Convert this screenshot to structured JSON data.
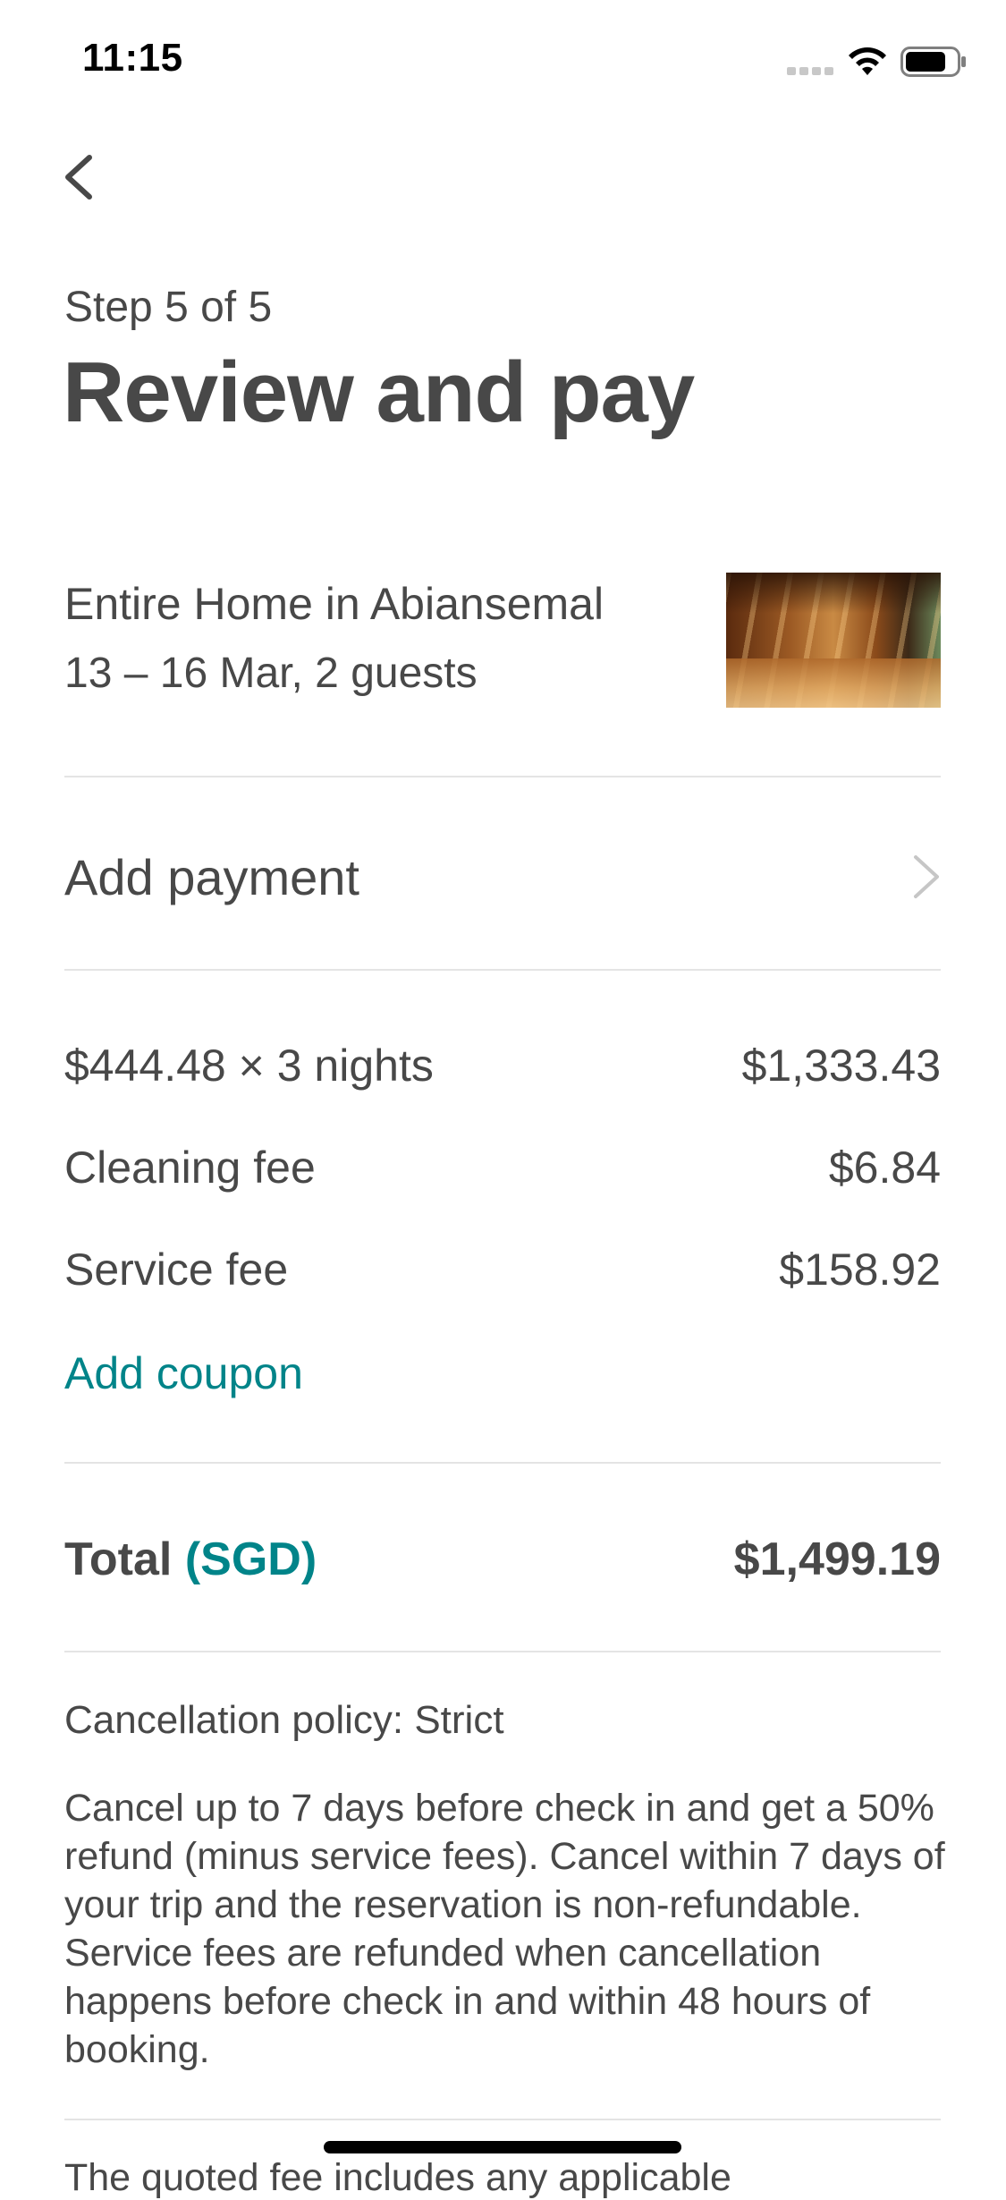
{
  "status_bar": {
    "time": "11:15"
  },
  "header": {
    "step": "Step 5 of 5",
    "title": "Review and pay"
  },
  "listing": {
    "title": "Entire Home in Abiansemal",
    "details": "13 – 16 Mar, 2 guests"
  },
  "payment": {
    "label": "Add payment"
  },
  "price_breakdown": {
    "rows": [
      {
        "label": "$444.48 × 3 nights",
        "value": "$1,333.43"
      },
      {
        "label": "Cleaning fee",
        "value": "$6.84"
      },
      {
        "label": "Service fee",
        "value": "$158.92"
      }
    ],
    "coupon_label": "Add coupon"
  },
  "total": {
    "label": "Total",
    "currency": "(SGD)",
    "value": "$1,499.19"
  },
  "cancellation": {
    "title": "Cancellation policy: Strict",
    "body": "Cancel up to 7 days before check in and get a 50% refund (minus service fees). Cancel within 7 days of your trip and the reservation is non-refundable. Service fees are refunded when cancellation happens before check in and within 48 hours of booking."
  },
  "footer": {
    "text": "The quoted fee includes any applicable"
  },
  "colors": {
    "text": "#484848",
    "accent": "#008489",
    "divider": "#e4e4e4"
  },
  "icons": {
    "back": "chevron-left-icon",
    "payment": "chevron-right-icon",
    "wifi": "wifi-icon",
    "battery": "battery-icon",
    "signal": "signal-icon"
  }
}
